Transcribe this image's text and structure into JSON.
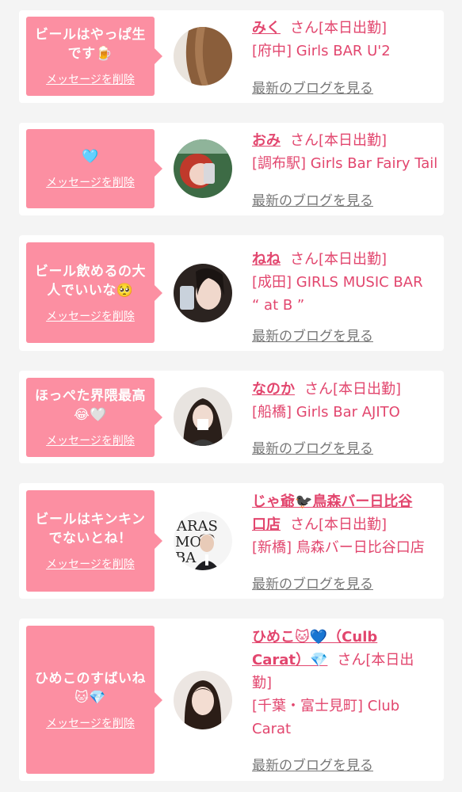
{
  "common": {
    "delete_label": "メッセージを削除",
    "san": "さん",
    "status": "[本日出勤]",
    "blog_label": "最新のブログを見る"
  },
  "colors": {
    "accent": "#e2466e",
    "bubble": "#fc8fa2"
  },
  "cards": [
    {
      "msg1": "ビールはやっぱ生",
      "msg2": "です🍺",
      "name": "みく",
      "shop1": "[府中] Girls BAR U'2"
    },
    {
      "msg1": "🩵",
      "name": "おみ",
      "shop1": "[調布駅] Girls Bar Fairy Tail"
    },
    {
      "msg1": "ビール飲めるの大",
      "msg2": "人でいいな🥺",
      "name": "ねね",
      "shop1": "[成田] GIRLS MUSIC BAR",
      "shop2": "“ at B ”"
    },
    {
      "msg1": "ほっぺた界隈最高",
      "msg2": "😂🤍",
      "name": "なのか",
      "shop1": "[船橋] Girls Bar AJITO"
    },
    {
      "msg1": "ビールはキンキン",
      "msg2": "でないとね！",
      "name1": "じゃ爺🐦‍⬛鳥森バー日比谷",
      "name2": "口店",
      "shop1": "[新橋] 鳥森バー日比谷口店"
    },
    {
      "msg1": "ひめこのすばいね",
      "msg2": "🐱💎",
      "name1": "ひめこ🐱💙（Culb",
      "name2": "Carat）💎",
      "status_a": "[本日出",
      "status_b": "勤]",
      "shop1": "[千葉・富士見町] Club",
      "shop2": "Carat"
    }
  ]
}
